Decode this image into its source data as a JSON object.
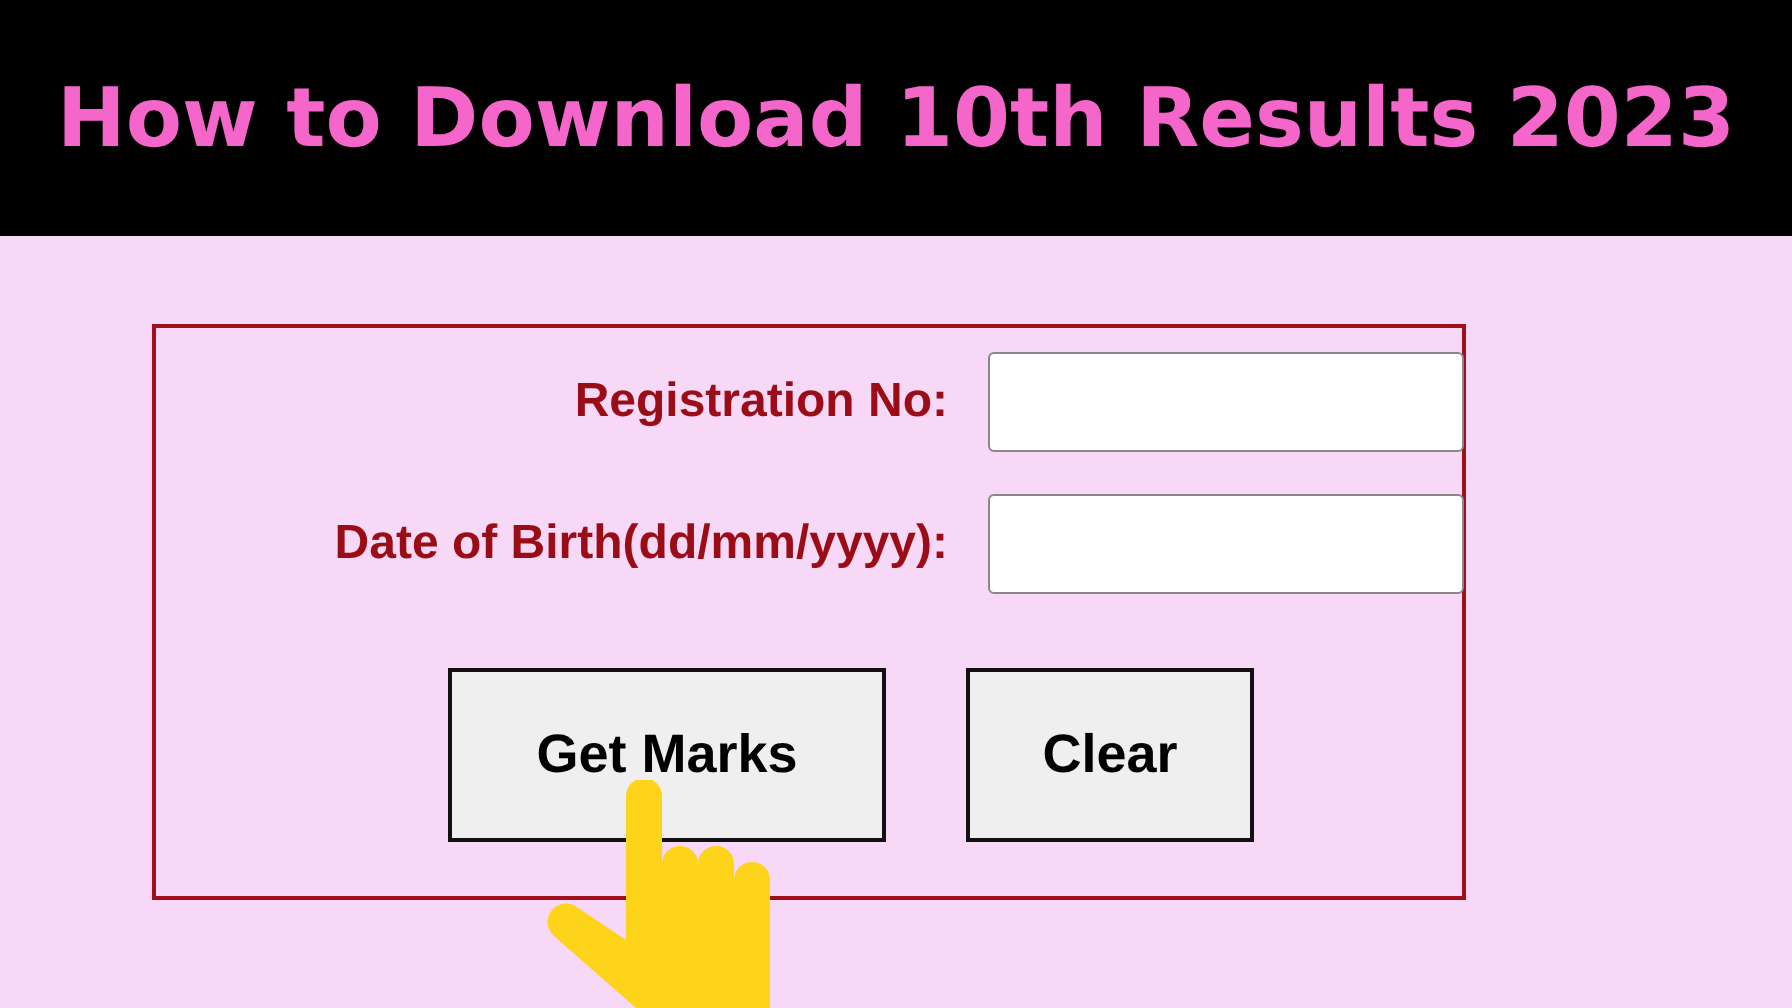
{
  "banner": {
    "title": "How to Download 10th Results 2023"
  },
  "form": {
    "fields": [
      {
        "label": "Registration No:"
      },
      {
        "label": "Date of Birth(dd/mm/yyyy):"
      }
    ],
    "buttons": [
      "Get Marks",
      "Clear"
    ]
  }
}
